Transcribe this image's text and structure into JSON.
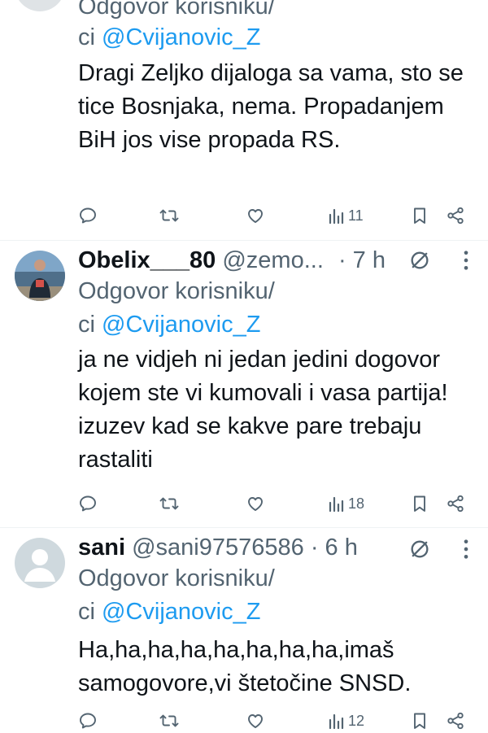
{
  "tweets": [
    {
      "name": "",
      "handle": "",
      "time": "",
      "reply_prefix": "Odgovor korisniku/",
      "reply_ci": "ci ",
      "reply_mention": "@Cvijanovic_Z",
      "body": "Dragi Zeljko dijaloga sa vama, sto se tice Bosnjaka, nema. Propadanjem BiH jos vise propada RS.",
      "views": "11"
    },
    {
      "name": "Obelix___80",
      "handle": "@zemo...",
      "time": "· 7 h",
      "reply_prefix": "Odgovor korisniku/",
      "reply_ci": "ci ",
      "reply_mention": "@Cvijanovic_Z",
      "body": "ja ne vidjeh ni jedan jedini dogovor kojem ste vi kumovali i vasa partija! izuzev kad se kakve pare trebaju rastaliti",
      "views": "18"
    },
    {
      "name": "sani",
      "handle": "@sani97576586",
      "time": "· 6 h",
      "reply_prefix": "Odgovor korisniku/",
      "reply_ci": "ci ",
      "reply_mention": "@Cvijanovic_Z",
      "body": "Ha,ha,ha,ha,ha,ha,ha,ha,imaš samogovore,vi štetočine SNSD.",
      "views": "12"
    }
  ],
  "icons": {
    "reply": "reply-icon",
    "retweet": "retweet-icon",
    "like": "like-icon",
    "views": "views-icon",
    "bookmark": "bookmark-icon",
    "share": "share-icon",
    "verified": "grok-slash-icon",
    "more": "more-icon"
  },
  "colors": {
    "mention": "#1d9bf0",
    "muted": "#536471",
    "text": "#0f1419"
  }
}
